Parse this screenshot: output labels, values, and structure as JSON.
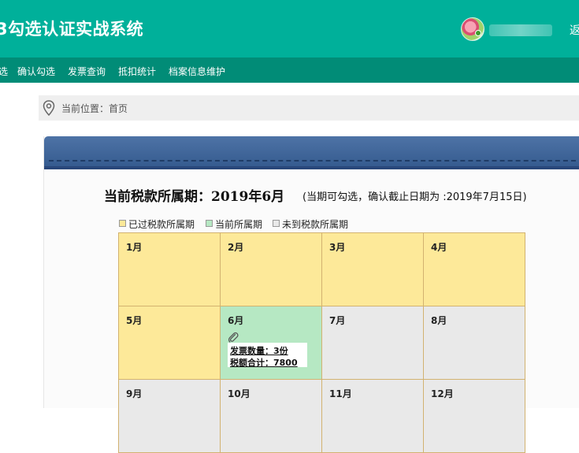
{
  "header": {
    "app_title": "3勾选认证实战系统",
    "logout": "返"
  },
  "nav": {
    "items": [
      {
        "label": "选"
      },
      {
        "label": "确认勾选"
      },
      {
        "label": "发票查询"
      },
      {
        "label": "抵扣统计"
      },
      {
        "label": "档案信息维护"
      }
    ]
  },
  "breadcrumb": {
    "label": "当前位置：",
    "current": "首页"
  },
  "period": {
    "title": "当前税款所属期：2019年6月",
    "note": "(当期可勾选，确认截止日期为 :2019年7月15日)"
  },
  "legend": [
    {
      "label": "已过税款所属期",
      "color": "#fde999"
    },
    {
      "label": "当前所属期",
      "color": "#b6e8c3"
    },
    {
      "label": "未到税款所属期",
      "color": "#e9e9e9"
    }
  ],
  "calendar": {
    "months": [
      {
        "label": "1月",
        "status": "past"
      },
      {
        "label": "2月",
        "status": "past"
      },
      {
        "label": "3月",
        "status": "past"
      },
      {
        "label": "4月",
        "status": "past"
      },
      {
        "label": "5月",
        "status": "past"
      },
      {
        "label": "6月",
        "status": "current",
        "invoice_count": "发票数量：3份",
        "tax_total": "税额合计：7800"
      },
      {
        "label": "7月",
        "status": "future"
      },
      {
        "label": "8月",
        "status": "future"
      },
      {
        "label": "9月",
        "status": "future"
      },
      {
        "label": "10月",
        "status": "future"
      },
      {
        "label": "11月",
        "status": "future"
      },
      {
        "label": "12月",
        "status": "future"
      }
    ]
  },
  "colors": {
    "header": "#00b09a",
    "nav": "#018c77",
    "banner": "#3d6397"
  }
}
